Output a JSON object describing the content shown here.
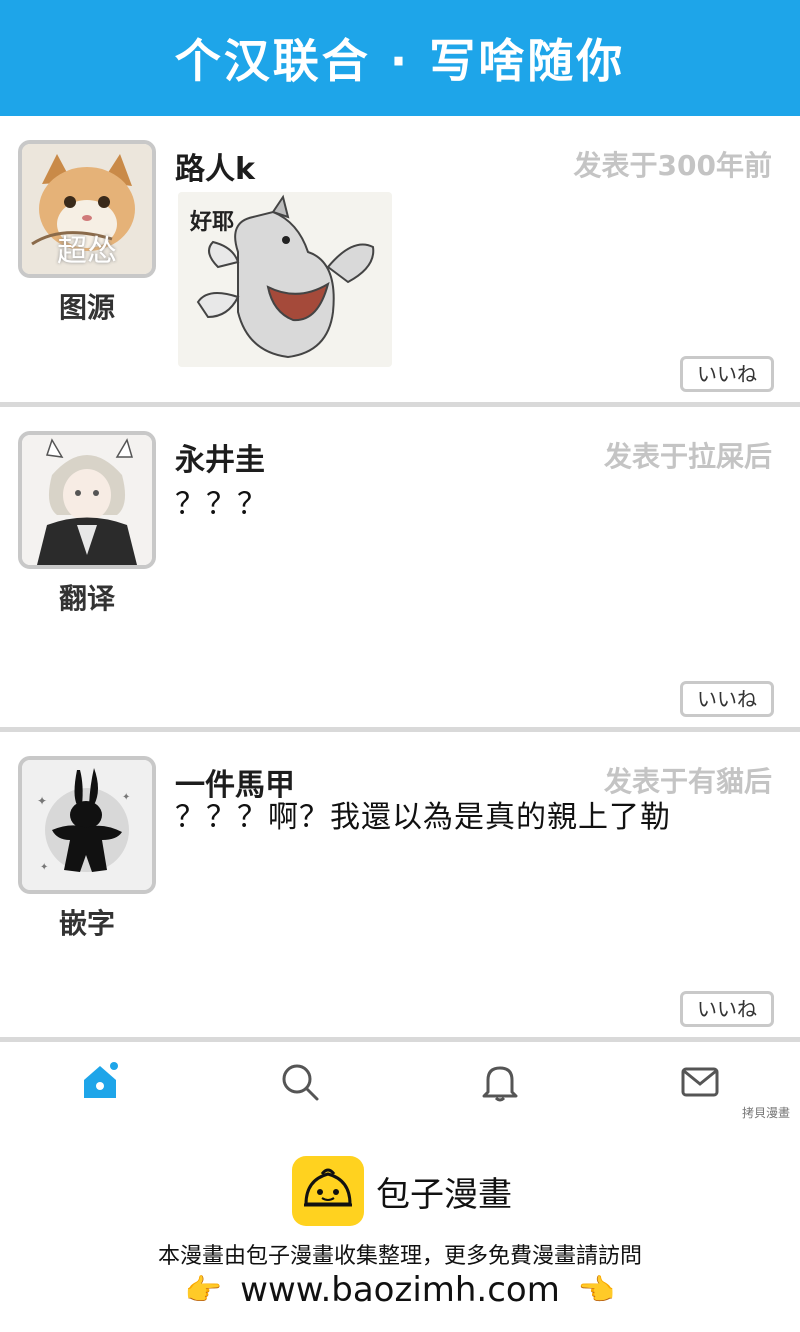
{
  "header": {
    "title": "个汉联合 · 写啥随你"
  },
  "posts": [
    {
      "username": "路人k",
      "timestamp": "发表于300年前",
      "avatar_caption": "图源",
      "avatar_overlay": "超怂",
      "sticker_text": "好耶",
      "text": "",
      "like_label": "いいね"
    },
    {
      "username": "永井圭",
      "timestamp": "发表于拉屎后",
      "avatar_caption": "翻译",
      "text": "？？？",
      "like_label": "いいね"
    },
    {
      "username": "一件馬甲",
      "timestamp": "发表于有貓后",
      "avatar_caption": "嵌字",
      "text": "？？？啊？我還以為是真的親上了勒",
      "like_label": "いいね"
    }
  ],
  "tabbar": {
    "items": [
      "home-icon",
      "search-icon",
      "bell-icon",
      "mail-icon"
    ],
    "active": "home-icon",
    "accent": "#1ea5e9"
  },
  "watermark": "拷貝漫畫",
  "footer": {
    "brand": "包子漫畫",
    "notice": "本漫畫由包子漫畫收集整理，更多免費漫畫請訪問",
    "url": "www.baozimh.com",
    "hand_left": "👉",
    "hand_right": "👈"
  }
}
